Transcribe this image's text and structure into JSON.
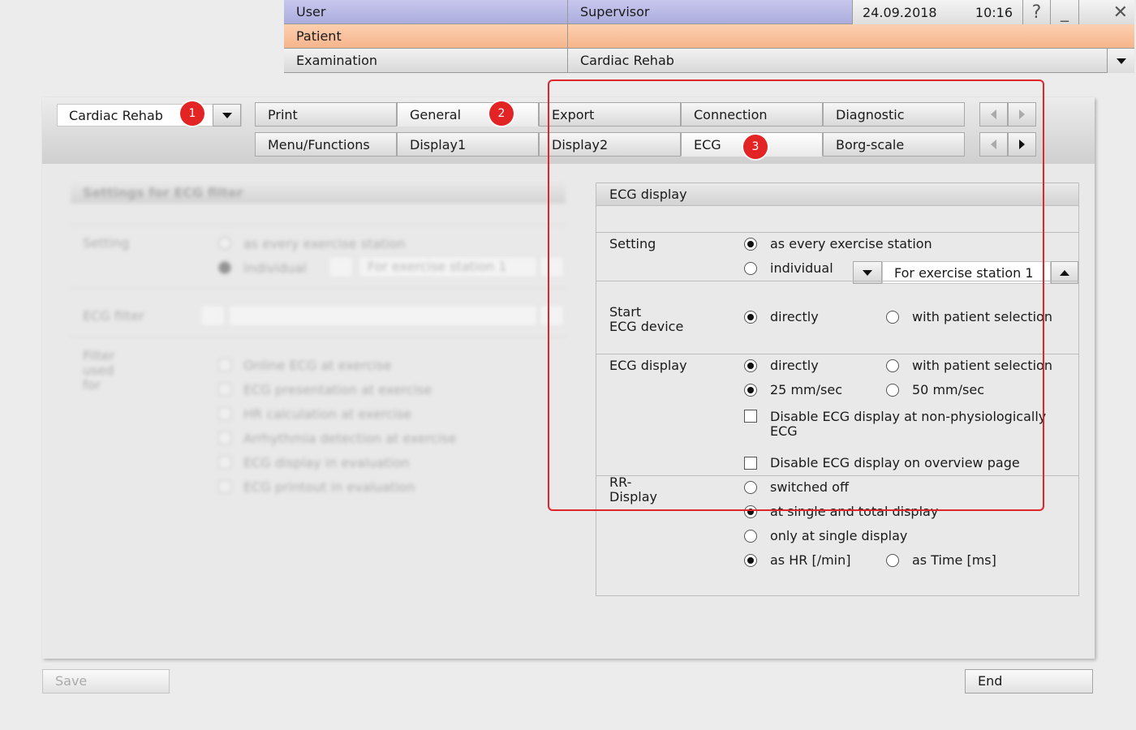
{
  "header": {
    "user_label": "User",
    "user_value": "Supervisor",
    "date": "24.09.2018",
    "time": "10:16",
    "help_glyph": "?",
    "minimize_glyph": "_",
    "close_glyph": "✕",
    "patient_label": "Patient",
    "patient_value": "",
    "exam_label": "Examination",
    "exam_value": "Cardiac Rehab",
    "colors": {
      "user_row": "#b9b9e6",
      "patient_row": "#f8c29c"
    }
  },
  "program": {
    "value": "Cardiac Rehab"
  },
  "tabs": {
    "row1": [
      "Print",
      "General",
      "Export",
      "Connection",
      "Diagnostic"
    ],
    "row2": [
      "Menu/Functions",
      "Display1",
      "Display2",
      "ECG",
      "Borg-scale"
    ],
    "active": "ECG"
  },
  "badges": [
    "1",
    "2",
    "3"
  ],
  "filter_group": {
    "title": "Settings for ECG filter",
    "setting_label": "Setting",
    "opt_every": "as every exercise station",
    "opt_individual": "individual",
    "station": "For exercise station 1",
    "filter_label": "ECG filter",
    "used_for_label": "Filter used for",
    "used_for": [
      "Online ECG at exercise",
      "ECG presentation at exercise",
      "HR calculation at exercise",
      "Arrhythmia detection at exercise",
      "ECG display in evaluation",
      "ECG printout in evaluation"
    ]
  },
  "ecg_display": {
    "title": "ECG display",
    "setting_label": "Setting",
    "opt_every_station": "as every exercise station",
    "opt_individual": "individual",
    "station_value": "For exercise station 1",
    "start_label_1": "Start",
    "start_label_2": "ECG device",
    "start_directly": "directly",
    "start_patient_sel": "with patient selection",
    "display_label": "ECG display",
    "display_directly": "directly",
    "display_patient_sel": "with patient selection",
    "speed_25": "25 mm/sec",
    "speed_50": "50 mm/sec",
    "disable_nonphys_1": "Disable ECG display at non-physiologically",
    "disable_nonphys_2": "ECG",
    "disable_overview": "Disable ECG display on overview page",
    "rr_label_1": "RR-",
    "rr_label_2": "Display",
    "rr_off": "switched off",
    "rr_single_total": "at single and total display",
    "rr_single_only": "only at single display",
    "rr_hr": "as HR [/min]",
    "rr_time": "as Time [ms]"
  },
  "footer": {
    "save": "Save",
    "end": "End"
  },
  "icons": [
    "help-icon",
    "minimize-icon",
    "close-icon",
    "chevron-down-icon",
    "chevron-up-icon",
    "arrow-left-icon",
    "arrow-right-icon"
  ]
}
